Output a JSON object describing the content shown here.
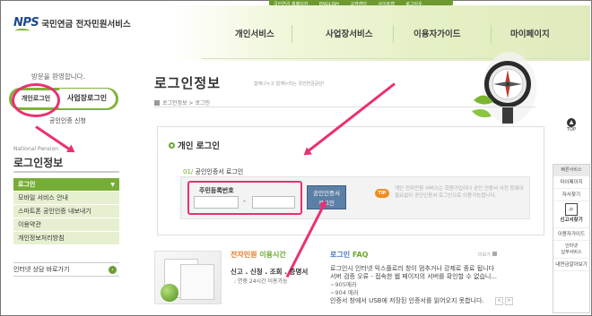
{
  "header": {
    "brand_abbr": "NPS",
    "brand_name": "국민연금 전자민원서비스",
    "top_links": [
      "국민연금 홈페이지",
      "ENGLISH",
      "고객센터",
      "사이트맵",
      "로그아웃"
    ],
    "gnb": [
      "개인서비스",
      "사업장서비스",
      "이용자가이드",
      "마이페이지"
    ]
  },
  "left": {
    "welcome": "방문을 환영합니다.",
    "personal_login": "개인로그인",
    "business_login": "사업장로그인",
    "cert_link": "공인인증 신청",
    "section_en": "National Pension",
    "section_title": "로그인정보",
    "menu": [
      {
        "label": "로그인",
        "active": true
      },
      {
        "label": "모바일 서비스 안내",
        "active": false
      },
      {
        "label": "스마트폰 공인인증 내보내기",
        "active": false
      },
      {
        "label": "이용약관",
        "active": false
      },
      {
        "label": "개인정보처리방침",
        "active": false
      }
    ],
    "internet_consult": "인터넷 상담 바로가기"
  },
  "main": {
    "title": "로그인정보",
    "subtitle": "함께나누고 함께누리는 국민연금공단!",
    "breadcrumb": "로그인정보 > 로그인",
    "box_title": "개인 로그인",
    "step_num": "01/",
    "step_label": "공인인증서 로그인",
    "ssn_label": "주민등록번호",
    "ssn_dash": "-",
    "cert_button_line1": "공인인증서",
    "cert_button_line2": "로그인",
    "tip_label": "TIP",
    "tip_text": "개인 전자민원 서비스는 회원가입이나 공인 인증서 사전 등록이 필요없이 공인인증서 로그인으로 이용가능합니다."
  },
  "promo": {
    "title_a": "전자민원",
    "title_b": "이용시간",
    "line1": "신고 . 신청 . 조회 . 증명서",
    "line2": ": 연중 24시간 이용가능"
  },
  "faq": {
    "title_a": "로그인",
    "title_b": "FAQ",
    "more": "더보기",
    "lines": [
      "로그인시 인터넷 익스플로러 창이 멈추거나 강제로 종료 됩니다",
      "서버 검증 오류 - 접속한 웹 페이지의 서버를 확인할 수 없습니...",
      "~905에러",
      "~904 에러",
      "인증서 창에서 USB에 저장된 인증서를 읽어오지 못합니다."
    ],
    "nav_prev": "<",
    "nav_next": ">"
  },
  "quick": {
    "top": "TOP",
    "head": "빠른서비스",
    "items": [
      "마이페이지",
      "자사찾기"
    ],
    "calc": "신고서찾기",
    "items2": [
      "이용자가이드"
    ],
    "two_lines": [
      "인터넷",
      "납부서비스"
    ],
    "last": "내연금알아보기"
  },
  "colors": {
    "accent": "#6ba72c",
    "highlight": "#ec2f72",
    "button": "#5c7fa6"
  }
}
